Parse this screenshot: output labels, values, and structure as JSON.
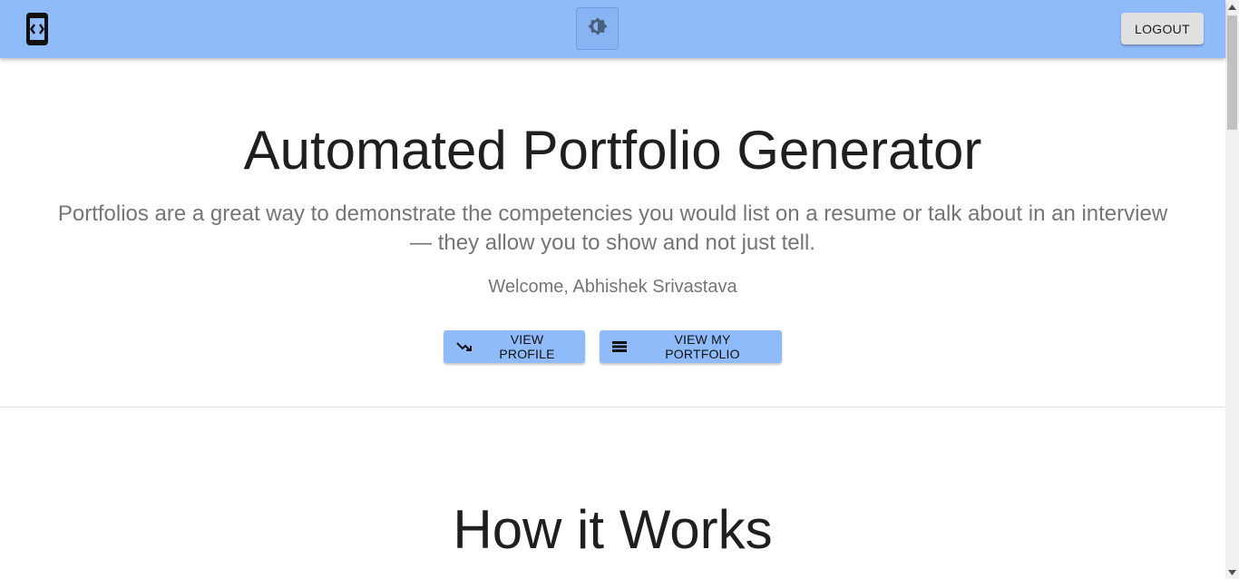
{
  "header": {
    "logo_icon": "code-brackets-icon",
    "theme_toggle_icon": "brightness-icon",
    "logout_label": "LOGOUT",
    "accent_color": "#90bbfa"
  },
  "hero": {
    "title": "Automated Portfolio Generator",
    "description": "Portfolios are a great way to demonstrate the competencies you would list on a resume or talk about in an interview — they allow you to show and not just tell.",
    "welcome": "Welcome, Abhishek Srivastava",
    "buttons": [
      {
        "label": "VIEW PROFILE",
        "icon": "trending-icon"
      },
      {
        "label": "VIEW MY PORTFOLIO",
        "icon": "portfolio-icon"
      }
    ]
  },
  "section": {
    "title": "How it Works"
  }
}
